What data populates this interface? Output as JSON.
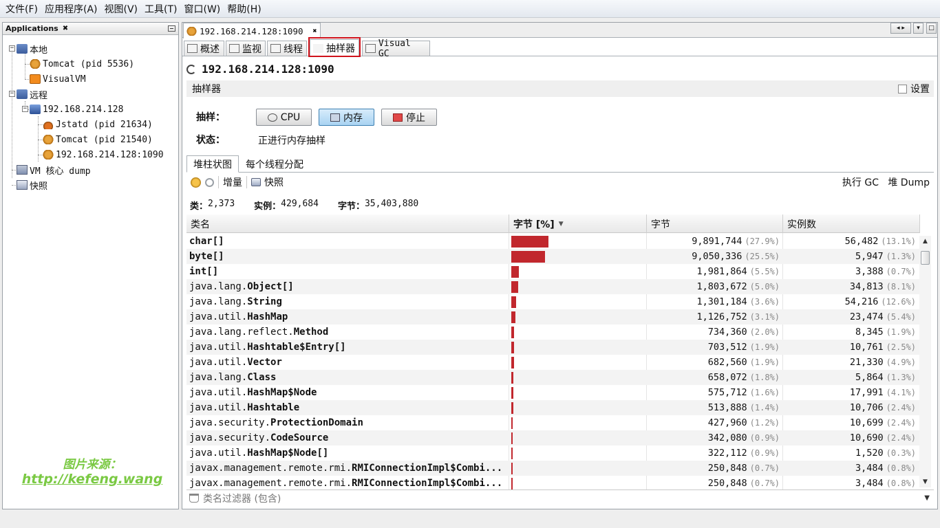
{
  "menu": [
    "文件(F)",
    "应用程序(A)",
    "视图(V)",
    "工具(T)",
    "窗口(W)",
    "帮助(H)"
  ],
  "left_panel": {
    "title": "Applications",
    "tree": [
      {
        "label": "本地",
        "icon": "computer-icon"
      },
      {
        "label": "Tomcat (pid 5536)",
        "icon": "tomcat-icon"
      },
      {
        "label": "VisualVM",
        "icon": "visualvm-icon"
      },
      {
        "label": "远程",
        "icon": "remote-icon"
      },
      {
        "label": "192.168.214.128",
        "icon": "host-icon"
      },
      {
        "label": "Jstatd (pid 21634)",
        "icon": "java-icon"
      },
      {
        "label": "Tomcat (pid 21540)",
        "icon": "tomcat-icon"
      },
      {
        "label": "192.168.214.128:1090",
        "icon": "jmx-icon"
      },
      {
        "label": "VM 核心 dump",
        "icon": "coredump-icon"
      },
      {
        "label": "快照",
        "icon": "snapshot-icon"
      }
    ]
  },
  "watermark": {
    "line1": "图片来源：",
    "line2": "http://kefeng.wang"
  },
  "doc_tab": {
    "label": "192.168.214.128:1090"
  },
  "sub_tabs": [
    "概述",
    "监视",
    "线程",
    "抽样器",
    "Visual GC"
  ],
  "title": "192.168.214.128:1090",
  "panel": {
    "name": "抽样器",
    "settings": "设置"
  },
  "sampling": {
    "label": "抽样：",
    "cpu": "CPU",
    "memory": "内存",
    "stop": "停止",
    "status_label": "状态：",
    "status": "正进行内存抽样"
  },
  "inner_tabs": [
    "堆柱状图",
    "每个线程分配"
  ],
  "toolbar": {
    "delta": "增量",
    "snapshot": "快照",
    "gc": "执行 GC",
    "heap_dump": "堆 Dump"
  },
  "stats": {
    "classes_label": "类：",
    "classes": "2,373",
    "instances_label": "实例：",
    "instances": "429,684",
    "bytes_label": "字节：",
    "bytes": "35,403,880"
  },
  "columns": {
    "name": "类名",
    "bytes_pct": "字节 [%]",
    "bytes": "字节",
    "instances": "实例数"
  },
  "rows": [
    {
      "pkg": "",
      "cls": "char[]",
      "bytes": "9,891,744",
      "bytes_pct": "(27.9%)",
      "inst": "56,482",
      "inst_pct": "(13.1%)",
      "share": 27.9
    },
    {
      "pkg": "",
      "cls": "byte[]",
      "bytes": "9,050,336",
      "bytes_pct": "(25.5%)",
      "inst": "5,947",
      "inst_pct": "(1.3%)",
      "share": 25.5
    },
    {
      "pkg": "",
      "cls": "int[]",
      "bytes": "1,981,864",
      "bytes_pct": "(5.5%)",
      "inst": "3,388",
      "inst_pct": "(0.7%)",
      "share": 5.5
    },
    {
      "pkg": "java.lang.",
      "cls": "Object[]",
      "bytes": "1,803,672",
      "bytes_pct": "(5.0%)",
      "inst": "34,813",
      "inst_pct": "(8.1%)",
      "share": 5.0
    },
    {
      "pkg": "java.lang.",
      "cls": "String",
      "bytes": "1,301,184",
      "bytes_pct": "(3.6%)",
      "inst": "54,216",
      "inst_pct": "(12.6%)",
      "share": 3.6
    },
    {
      "pkg": "java.util.",
      "cls": "HashMap",
      "bytes": "1,126,752",
      "bytes_pct": "(3.1%)",
      "inst": "23,474",
      "inst_pct": "(5.4%)",
      "share": 3.1
    },
    {
      "pkg": "java.lang.reflect.",
      "cls": "Method",
      "bytes": "734,360",
      "bytes_pct": "(2.0%)",
      "inst": "8,345",
      "inst_pct": "(1.9%)",
      "share": 2.0
    },
    {
      "pkg": "java.util.",
      "cls": "Hashtable$Entry[]",
      "bytes": "703,512",
      "bytes_pct": "(1.9%)",
      "inst": "10,761",
      "inst_pct": "(2.5%)",
      "share": 1.9
    },
    {
      "pkg": "java.util.",
      "cls": "Vector",
      "bytes": "682,560",
      "bytes_pct": "(1.9%)",
      "inst": "21,330",
      "inst_pct": "(4.9%)",
      "share": 1.9
    },
    {
      "pkg": "java.lang.",
      "cls": "Class",
      "bytes": "658,072",
      "bytes_pct": "(1.8%)",
      "inst": "5,864",
      "inst_pct": "(1.3%)",
      "share": 1.8
    },
    {
      "pkg": "java.util.",
      "cls": "HashMap$Node",
      "bytes": "575,712",
      "bytes_pct": "(1.6%)",
      "inst": "17,991",
      "inst_pct": "(4.1%)",
      "share": 1.6
    },
    {
      "pkg": "java.util.",
      "cls": "Hashtable",
      "bytes": "513,888",
      "bytes_pct": "(1.4%)",
      "inst": "10,706",
      "inst_pct": "(2.4%)",
      "share": 1.4
    },
    {
      "pkg": "java.security.",
      "cls": "ProtectionDomain",
      "bytes": "427,960",
      "bytes_pct": "(1.2%)",
      "inst": "10,699",
      "inst_pct": "(2.4%)",
      "share": 1.2
    },
    {
      "pkg": "java.security.",
      "cls": "CodeSource",
      "bytes": "342,080",
      "bytes_pct": "(0.9%)",
      "inst": "10,690",
      "inst_pct": "(2.4%)",
      "share": 0.9
    },
    {
      "pkg": "java.util.",
      "cls": "HashMap$Node[]",
      "bytes": "322,112",
      "bytes_pct": "(0.9%)",
      "inst": "1,520",
      "inst_pct": "(0.3%)",
      "share": 0.9
    },
    {
      "pkg": "javax.management.remote.rmi.",
      "cls": "RMIConnectionImpl$Combi...",
      "bytes": "250,848",
      "bytes_pct": "(0.7%)",
      "inst": "3,484",
      "inst_pct": "(0.8%)",
      "share": 0.7
    },
    {
      "pkg": "javax.management.remote.rmi.",
      "cls": "RMIConnectionImpl$Combi...",
      "bytes": "250,848",
      "bytes_pct": "(0.7%)",
      "inst": "3,484",
      "inst_pct": "(0.8%)",
      "share": 0.7
    }
  ],
  "filter": {
    "placeholder": "类名过滤器 (包含)"
  },
  "colors": {
    "bar": "#c1272d",
    "highlight": "#d0121b",
    "watermark": "#7ac943"
  }
}
